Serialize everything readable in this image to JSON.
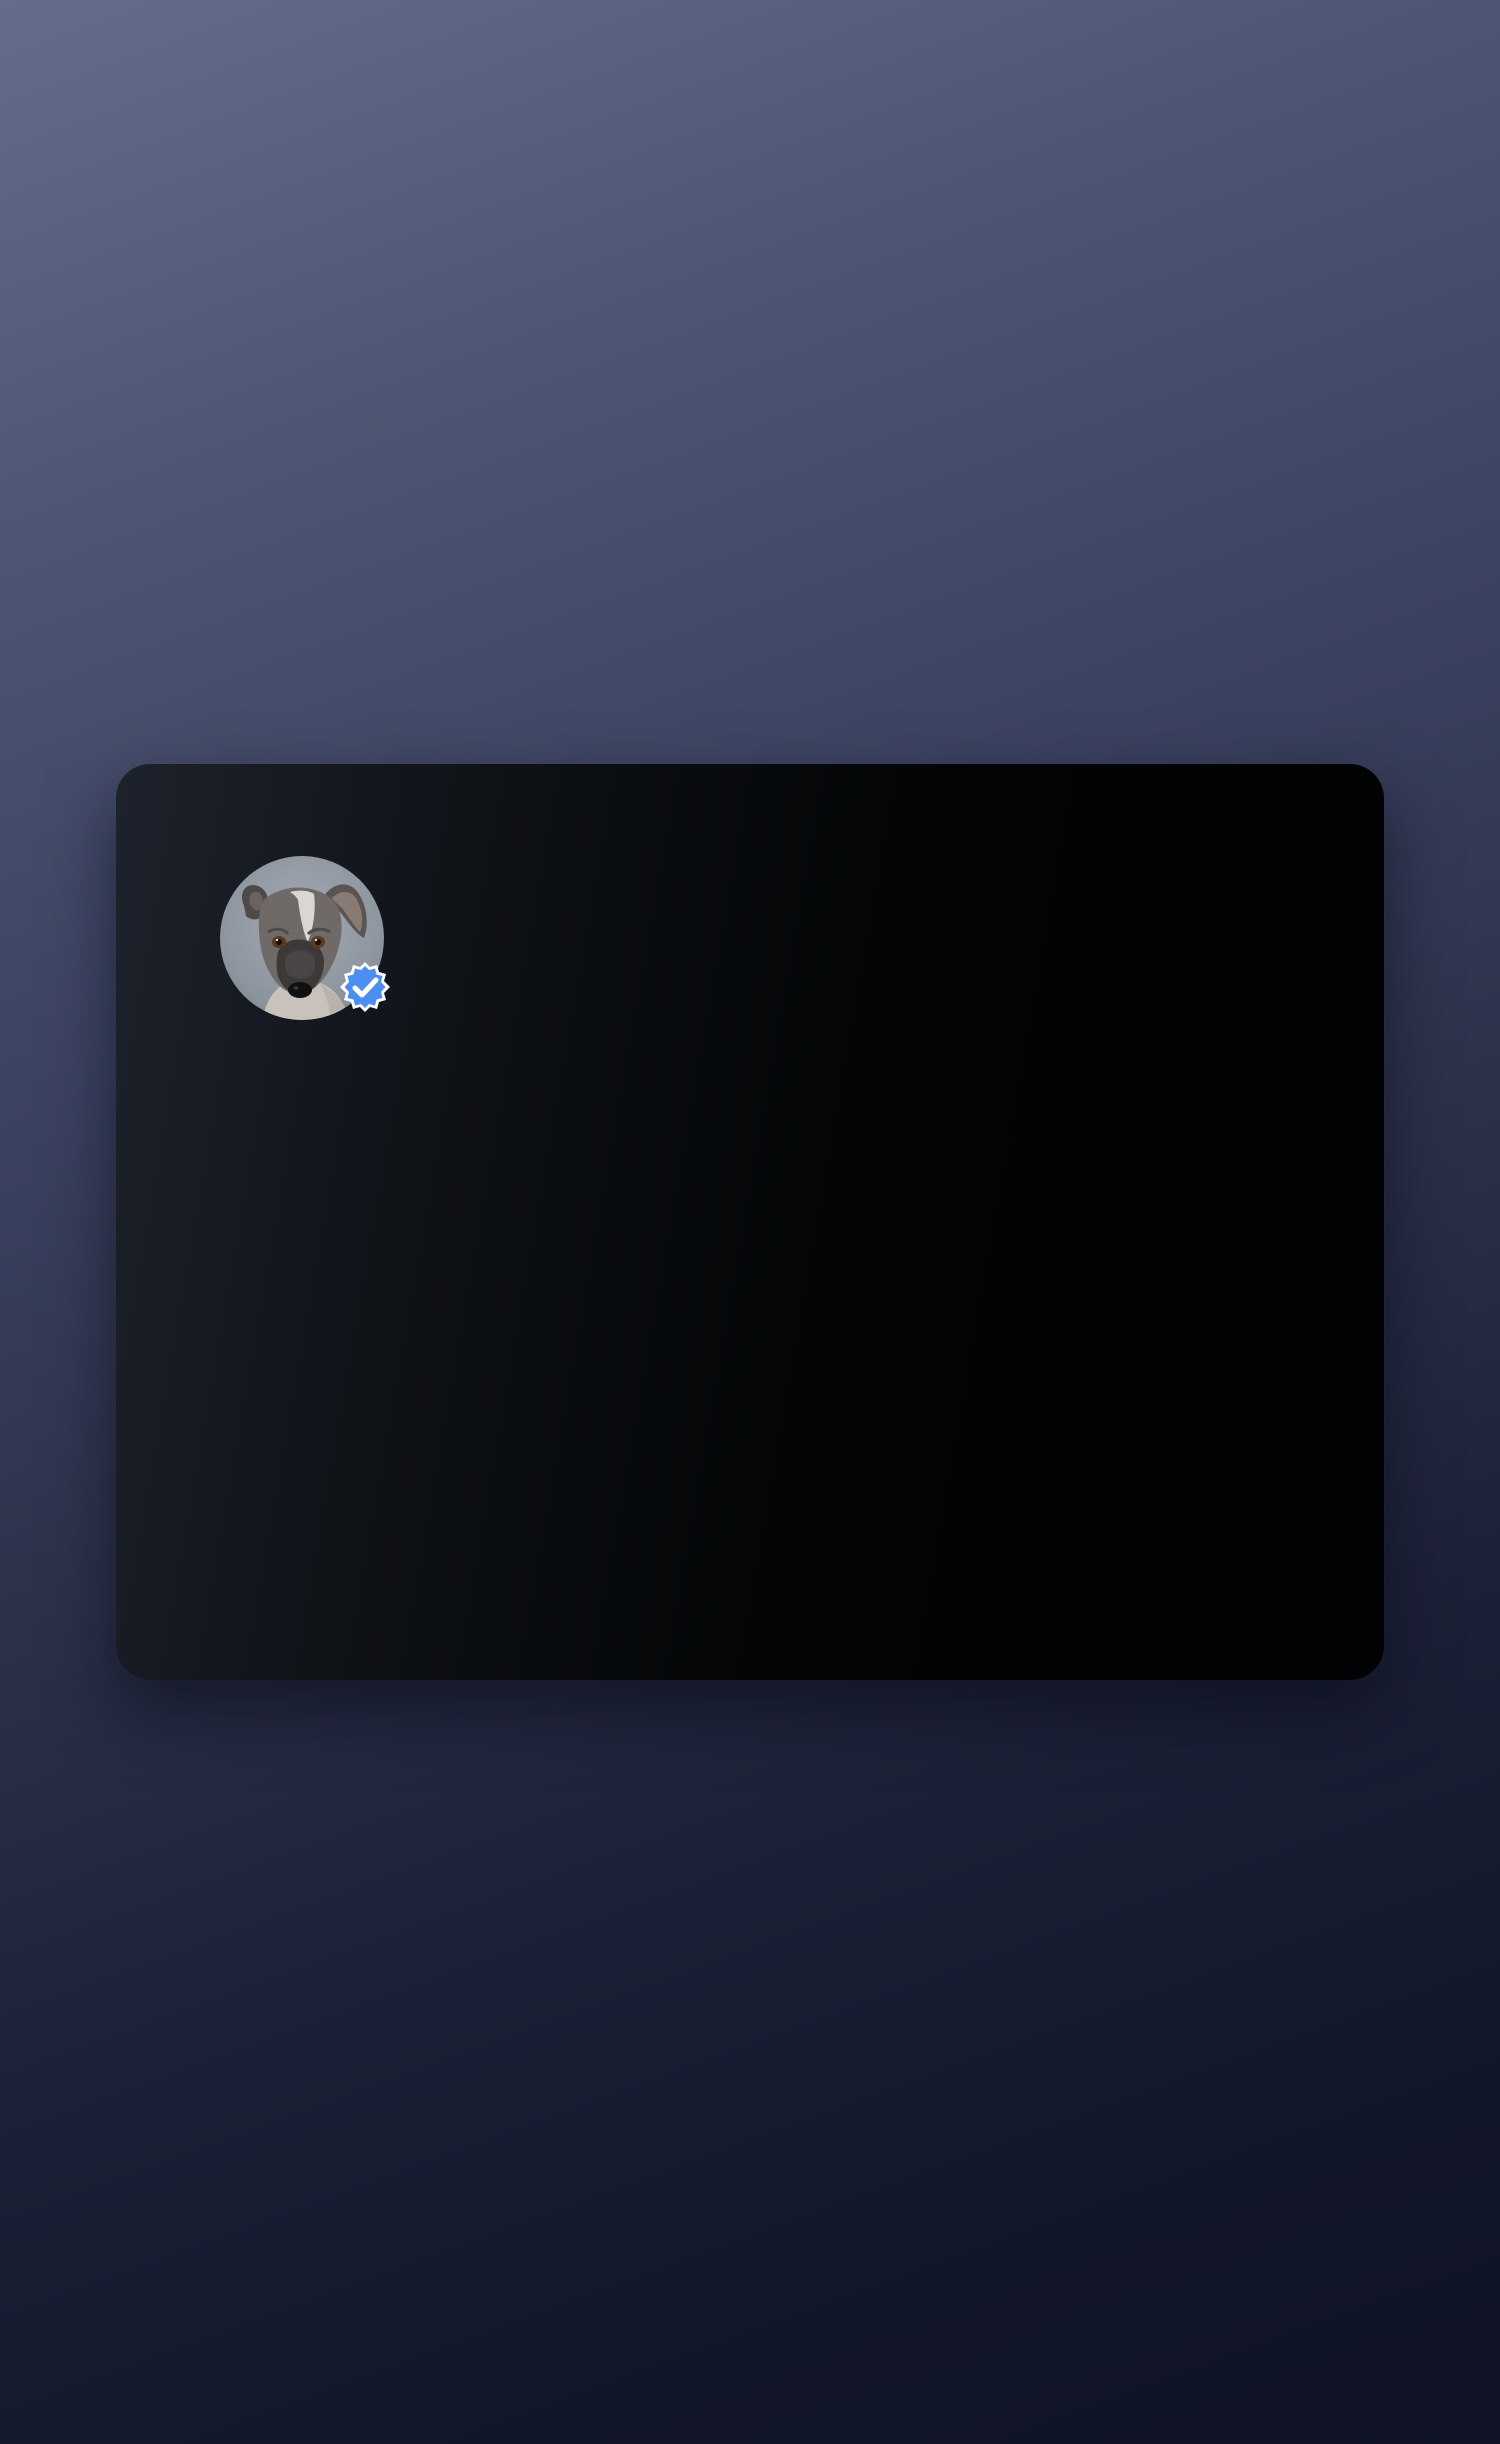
{
  "profile": {
    "avatar": {
      "subject": "dog-photo",
      "background_color": "#9aa1aa"
    },
    "badge": {
      "icon": "verified-badge-icon",
      "color": "#4d8ff0"
    }
  },
  "colors": {
    "card_dark": "#020405",
    "card_edge": "#1e222c",
    "background_top": "#646d8c",
    "background_bottom": "#0f1325"
  }
}
